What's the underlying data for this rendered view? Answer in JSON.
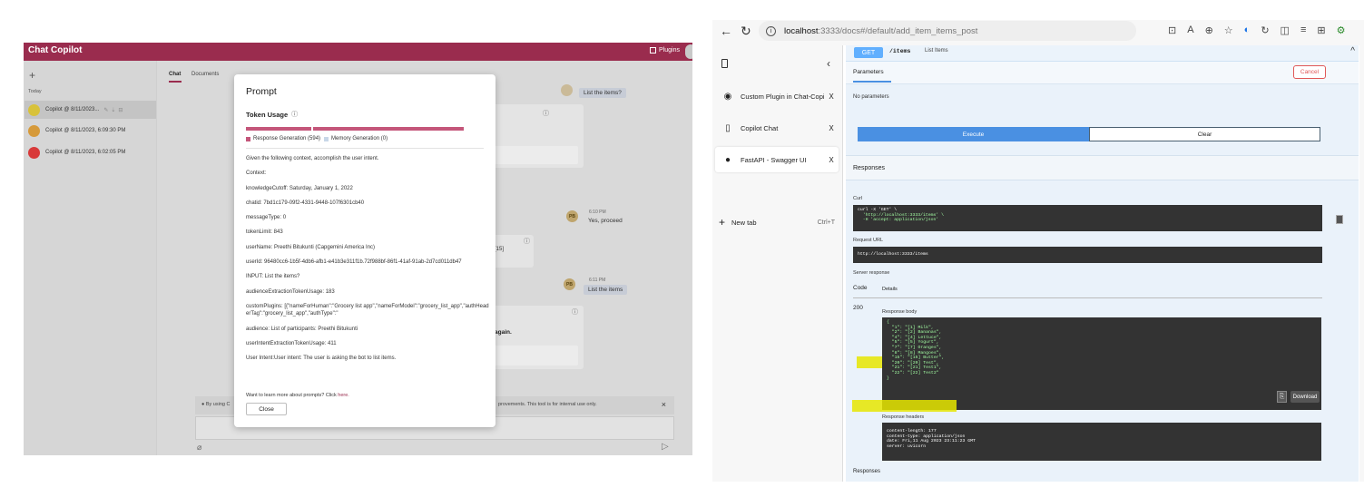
{
  "chat_copilot": {
    "title": "Chat Copilot",
    "plugins_label": "Plugins",
    "new_chat": "+",
    "today_label": "Today",
    "chats": [
      {
        "label": "Copilot @ 8/11/2023...",
        "color": "#d8c23a"
      },
      {
        "label": "Copilot @ 8/11/2023, 6:09:30 PM",
        "color": "#d69a3a"
      },
      {
        "label": "Copilot @ 8/11/2023, 6:02:05 PM",
        "color": "#d83a3a"
      }
    ],
    "tabs": {
      "chat": "Chat",
      "documents": "Documents"
    },
    "messages": {
      "user1": "List the items?",
      "pb_time": "6:10 PM",
      "user2": "Yes, proceed",
      "time3": "6:11 PM",
      "user3": "List the items",
      "fragment1": "[15]",
      "fragment2": "again."
    },
    "user_initials": "PB",
    "notice_left": "By using C",
    "notice_right": "provements. This tool is for internal use only.",
    "notice_close": "×",
    "accent": "#9a2c4e"
  },
  "prompt_modal": {
    "title": "Prompt",
    "token_usage_title": "Token Usage",
    "token_bar_fraction": 1.0,
    "legend": {
      "response": "Response Generation (594)",
      "memory": "Memory Generation (0)",
      "response_color": "#c4567a",
      "memory_color": "#c8d7e8"
    },
    "lines": [
      "Given the following context, accomplish the user intent.",
      "Context:",
      "knowledgeCutoff: Saturday, January 1, 2022",
      "chatid: 7bd1c179-09f2-4331-9448-107f6301cb40",
      "messageType: 0",
      "tokenLimit: 843",
      "userName: Preethi Bitukunti (Capgemini America Inc)",
      "userId: 96480cc6-1b5f-4db6-afb1-e41b3e311f1b.72f988bf-86f1-41af-91ab-2d7cd011db47",
      "INPUT: List the items?",
      "audienceExtractionTokenUsage: 183",
      "customPlugins: [{\"nameForHuman\":\"Grocery list app\",\"nameForModel\":\"grocery_list_app\",\"authHeaderTag\":\"grocery_list_app\",\"authType\":\"",
      "audience: List of participants: Preethi Bitukunti",
      "userIntentExtractionTokenUsage: 411",
      "User Intent:User intent: The user is asking the bot to list items."
    ],
    "learn_more": "Want to learn more about prompts? Click ",
    "learn_more_link": "here.",
    "close_label": "Close"
  },
  "browser": {
    "url_host": "localhost",
    "url_path": ":3333/docs#/default/add_item_items_post",
    "tabs": [
      {
        "label": "Custom Plugin in Chat-Copilot Fe",
        "icon": "github-icon"
      },
      {
        "label": "Copilot Chat",
        "icon": "page-icon"
      },
      {
        "label": "FastAPI - Swagger UI",
        "icon": "fastapi-icon"
      }
    ],
    "tab_close": "X",
    "new_tab_label": "New tab",
    "new_tab_shortcut": "Ctrl+T"
  },
  "swagger": {
    "method": "GET",
    "path": "/items",
    "summary": "List Items",
    "parameters_label": "Parameters",
    "cancel_label": "Cancel",
    "no_parameters": "No parameters",
    "execute_label": "Execute",
    "clear_label": "Clear",
    "responses_label": "Responses",
    "curl_label": "Curl",
    "curl_lines": [
      "curl -X 'GET' \\",
      "  'http://localhost:3333/items' \\",
      "  -H 'accept: application/json'"
    ],
    "request_url_label": "Request URL",
    "request_url": "http://localhost:3333/items",
    "server_response_label": "Server response",
    "code_header": "Code",
    "details_header": "Details",
    "status_code": "200",
    "response_body_label": "Response body",
    "response_body_lines": [
      "{",
      "  \"1\": \"[1] Milk\",",
      "  \"2\": \"[2] Bananas\",",
      "  \"4\": \"[4] Lettuce\",",
      "  \"5\": \"[5] Yogurt\",",
      "  \"7\": \"[7] Oranges\",",
      "  \"8\": \"[8] Mangoes\",",
      "  \"15\": \"[15] Butter\",",
      "  \"20\": \"[20] Test\",",
      "  \"21\": \"[21] Test1\",",
      "  \"22\": \"[22] Test2\"",
      "}"
    ],
    "download_label": "Download",
    "response_headers_label": "Response headers",
    "response_headers_lines": [
      "content-length: 177",
      "content-type: application/json",
      "date: Fri,11 Aug 2023 23:11:23 GMT",
      "server: uvicorn"
    ],
    "responses_bottom": "Responses",
    "highlight_color": "#e6e600",
    "get_color": "#61affe",
    "execute_color": "#4a90e2"
  }
}
